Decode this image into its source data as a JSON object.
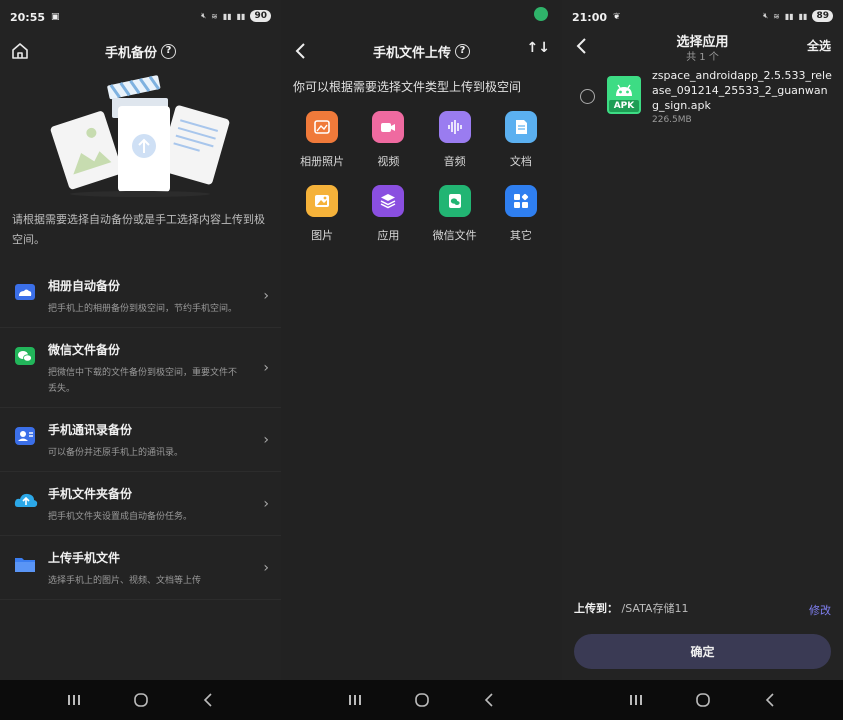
{
  "left": {
    "status": {
      "time": "20:55",
      "battery": "90"
    },
    "header": {
      "title": "手机备份",
      "help": "?"
    },
    "hint": "请根据需要选择自动备份或是手工选择内容上传到极空间。",
    "items": [
      {
        "title": "相册自动备份",
        "desc": "把手机上的相册备份到极空间，节约手机空间。",
        "icon": "album-cloud-icon",
        "color": "#3b6fe8"
      },
      {
        "title": "微信文件备份",
        "desc": "把微信中下载的文件备份到极空间，重要文件不丢失。",
        "icon": "wechat-icon",
        "color": "#22b55a"
      },
      {
        "title": "手机通讯录备份",
        "desc": "可以备份并还原手机上的通讯录。",
        "icon": "contacts-icon",
        "color": "#3b6fe8"
      },
      {
        "title": "手机文件夹备份",
        "desc": "把手机文件夹设置成自动备份任务。",
        "icon": "cloud-upload-icon",
        "color": "#2ca8e8"
      },
      {
        "title": "上传手机文件",
        "desc": "选择手机上的图片、视频、文档等上传",
        "icon": "folder-icon",
        "color": "#3b7ef0"
      }
    ]
  },
  "middle": {
    "header": {
      "title": "手机文件上传",
      "help": "?",
      "sort": "↑↓"
    },
    "hint": "你可以根据需要选择文件类型上传到极空间",
    "types": [
      {
        "label": "相册照片",
        "icon": "album-photo-icon",
        "color": "#f07a3a"
      },
      {
        "label": "视频",
        "icon": "video-icon",
        "color": "#ef6aa0"
      },
      {
        "label": "音频",
        "icon": "audio-icon",
        "color": "#9a7cf0"
      },
      {
        "label": "文档",
        "icon": "document-icon",
        "color": "#5bb0f0"
      },
      {
        "label": "图片",
        "icon": "image-icon",
        "color": "#f5b23a"
      },
      {
        "label": "应用",
        "icon": "apps-icon",
        "color": "#8a4fe0"
      },
      {
        "label": "微信文件",
        "icon": "wechat-file-icon",
        "color": "#22b573"
      },
      {
        "label": "其它",
        "icon": "other-icon",
        "color": "#2f7ff0"
      }
    ]
  },
  "right": {
    "status": {
      "time": "21:00",
      "battery": "89"
    },
    "header": {
      "title": "选择应用",
      "count": "共 1 个",
      "select_all": "全选"
    },
    "file": {
      "name": "zspace_androidapp_2.5.533_release_091214_25533_2_guanwang_sign.apk",
      "size": "226.5MB",
      "badge": "APK"
    },
    "upload": {
      "label": "上传到：",
      "path": "/SATA存储11",
      "edit": "修改"
    },
    "confirm": "确定"
  }
}
